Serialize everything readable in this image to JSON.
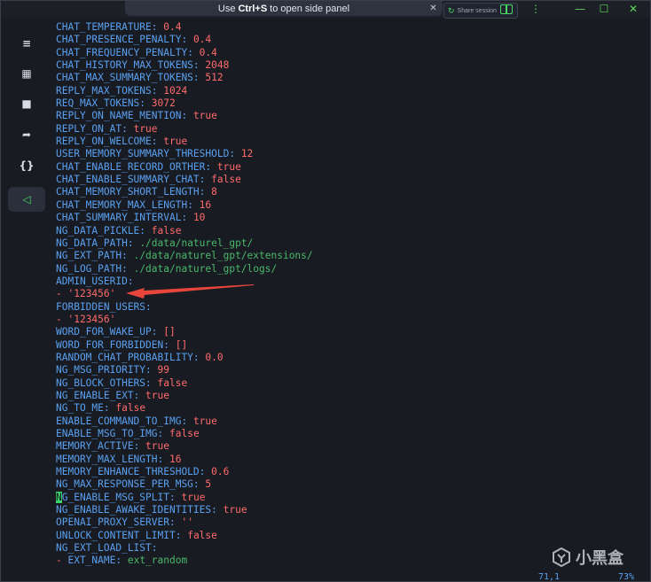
{
  "titlebar": {
    "hint_prefix": "Use",
    "hint_key": "Ctrl+S",
    "hint_suffix": "to open side panel",
    "share_label": "Share session"
  },
  "sidebar": {
    "items": [
      {
        "icon": "menu-icon",
        "glyph": "≡"
      },
      {
        "icon": "grid-icon",
        "glyph": "▦"
      },
      {
        "icon": "folder-icon",
        "glyph": "■"
      },
      {
        "icon": "forward-icon",
        "glyph": "➦"
      },
      {
        "icon": "braces-icon",
        "glyph": "{}"
      },
      {
        "icon": "snippets-icon",
        "glyph": "◁"
      }
    ]
  },
  "editor": {
    "lines": [
      {
        "key": "CHAT_TEMPERATURE",
        "value": "0.4",
        "type": "v"
      },
      {
        "key": "CHAT_PRESENCE_PENALTY",
        "value": "0.4",
        "type": "v"
      },
      {
        "key": "CHAT_FREQUENCY_PENALTY",
        "value": "0.4",
        "type": "v"
      },
      {
        "key": "CHAT_HISTORY_MAX_TOKENS",
        "value": "2048",
        "type": "v"
      },
      {
        "key": "CHAT_MAX_SUMMARY_TOKENS",
        "value": "512",
        "type": "v"
      },
      {
        "key": "REPLY_MAX_TOKENS",
        "value": "1024",
        "type": "v"
      },
      {
        "key": "REQ_MAX_TOKENS",
        "value": "3072",
        "type": "v"
      },
      {
        "key": "REPLY_ON_NAME_MENTION",
        "value": "true",
        "type": "v"
      },
      {
        "key": "REPLY_ON_AT",
        "value": "true",
        "type": "v"
      },
      {
        "key": "REPLY_ON_WELCOME",
        "value": "true",
        "type": "v"
      },
      {
        "key": "USER_MEMORY_SUMMARY_THRESHOLD",
        "value": "12",
        "type": "v"
      },
      {
        "key": "CHAT_ENABLE_RECORD_ORTHER",
        "value": "true",
        "type": "v"
      },
      {
        "key": "CHAT_ENABLE_SUMMARY_CHAT",
        "value": "false",
        "type": "v"
      },
      {
        "key": "CHAT_MEMORY_SHORT_LENGTH",
        "value": "8",
        "type": "v"
      },
      {
        "key": "CHAT_MEMORY_MAX_LENGTH",
        "value": "16",
        "type": "v"
      },
      {
        "key": "CHAT_SUMMARY_INTERVAL",
        "value": "10",
        "type": "v"
      },
      {
        "key": "NG_DATA_PICKLE",
        "value": "false",
        "type": "v"
      },
      {
        "key": "NG_DATA_PATH",
        "value": "./data/naturel_gpt/",
        "type": "p"
      },
      {
        "key": "NG_EXT_PATH",
        "value": "./data/naturel_gpt/extensions/",
        "type": "p"
      },
      {
        "key": "NG_LOG_PATH",
        "value": "./data/naturel_gpt/logs/",
        "type": "p"
      },
      {
        "key": "ADMIN_USERID",
        "value": "",
        "type": "v"
      },
      {
        "list": "'123456'",
        "type": "v"
      },
      {
        "key": "FORBIDDEN_USERS",
        "value": "",
        "type": "v"
      },
      {
        "list": "'123456'",
        "type": "v"
      },
      {
        "key": "WORD_FOR_WAKE_UP",
        "value": "[]",
        "type": "v"
      },
      {
        "key": "WORD_FOR_FORBIDDEN",
        "value": "[]",
        "type": "v"
      },
      {
        "key": "RANDOM_CHAT_PROBABILITY",
        "value": "0.0",
        "type": "v"
      },
      {
        "key": "NG_MSG_PRIORITY",
        "value": "99",
        "type": "v"
      },
      {
        "key": "NG_BLOCK_OTHERS",
        "value": "false",
        "type": "v"
      },
      {
        "key": "NG_ENABLE_EXT",
        "value": "true",
        "type": "v"
      },
      {
        "key": "NG_TO_ME",
        "value": "false",
        "type": "v"
      },
      {
        "key": "ENABLE_COMMAND_TO_IMG",
        "value": "true",
        "type": "v"
      },
      {
        "key": "ENABLE_MSG_TO_IMG",
        "value": "false",
        "type": "v"
      },
      {
        "key": "MEMORY_ACTIVE",
        "value": "true",
        "type": "v"
      },
      {
        "key": "MEMORY_MAX_LENGTH",
        "value": "16",
        "type": "v"
      },
      {
        "key": "MEMORY_ENHANCE_THRESHOLD",
        "value": "0.6",
        "type": "v"
      },
      {
        "key": "NG_MAX_RESPONSE_PER_MSG",
        "value": "5",
        "type": "v"
      },
      {
        "key": "NG_ENABLE_MSG_SPLIT",
        "value": "true",
        "type": "v",
        "cursor": true
      },
      {
        "key": "NG_ENABLE_AWAKE_IDENTITIES",
        "value": "true",
        "type": "v"
      },
      {
        "key": "OPENAI_PROXY_SERVER",
        "value": "''",
        "type": "v"
      },
      {
        "key": "UNLOCK_CONTENT_LIMIT",
        "value": "false",
        "type": "v"
      },
      {
        "key": "NG_EXT_LOAD_LIST",
        "value": "",
        "type": "v"
      },
      {
        "list_key": "EXT_NAME",
        "value": "ext_random",
        "type": "p"
      }
    ]
  },
  "status": {
    "position": "71,1",
    "percent": "73%"
  },
  "watermark": {
    "text": "小黑盒"
  },
  "colors": {
    "key": "#5aa0f0",
    "value": "#ff6b6b",
    "path": "#4ab86a",
    "accent": "#4cd964"
  }
}
